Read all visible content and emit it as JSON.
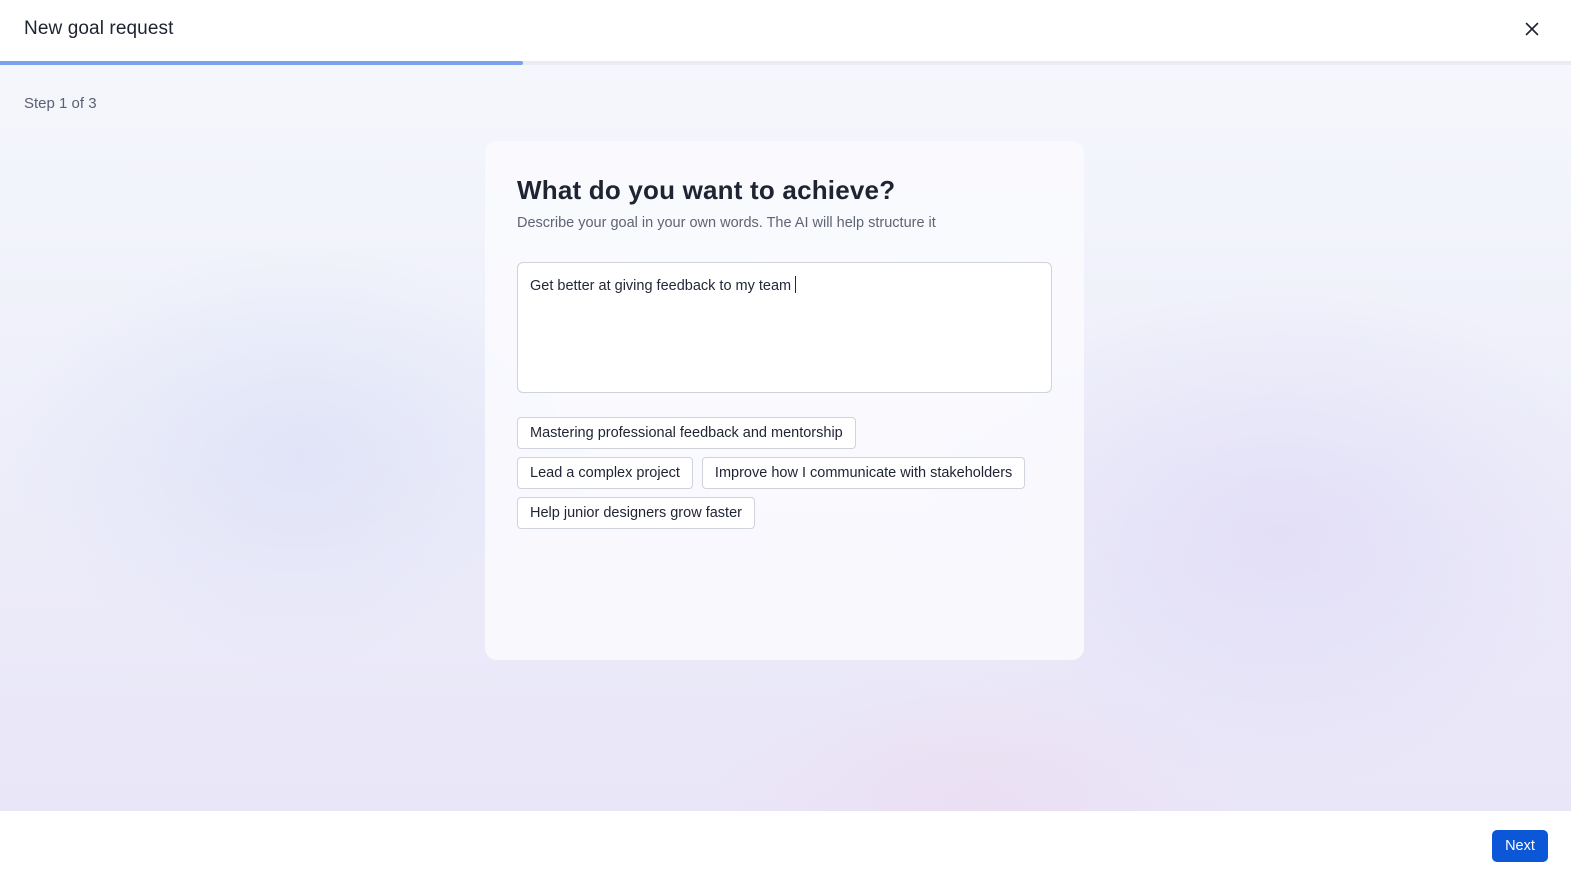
{
  "header": {
    "title": "New goal request",
    "close_icon": "close-icon"
  },
  "progress": {
    "current_step": 1,
    "total_steps": 3,
    "fraction": 0.333,
    "fill_color": "#7aa2ec"
  },
  "main": {
    "step_label": "Step 1 of 3",
    "card": {
      "title": "What do you want to achieve?",
      "subtitle": "Describe your goal in your own words. The AI will help structure it",
      "input_value": "Get better at giving feedback to my team",
      "suggestions": [
        "Mastering professional feedback and mentorship",
        "Lead a complex project",
        "Improve how I communicate with stakeholders",
        "Help junior designers grow faster"
      ]
    }
  },
  "footer": {
    "next_label": "Next",
    "accent_color": "#0b57d8"
  }
}
